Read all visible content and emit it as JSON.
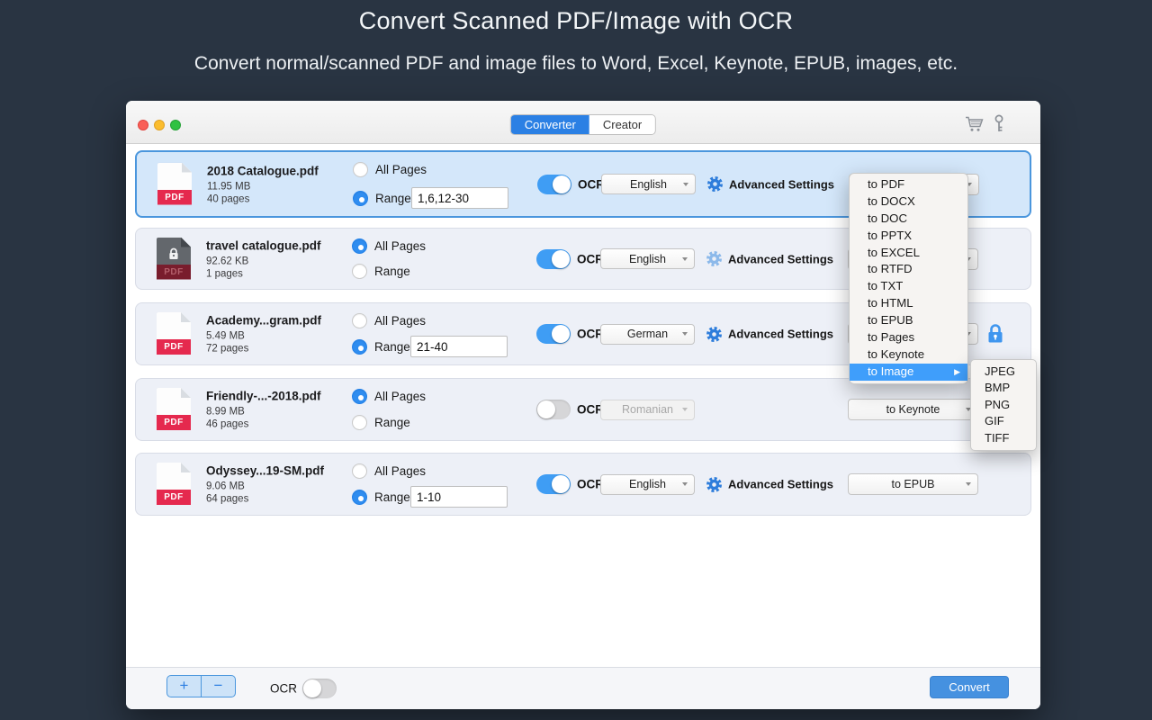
{
  "page": {
    "title": "Convert Scanned PDF/Image with OCR",
    "subtitle": "Convert normal/scanned PDF and image files to Word, Excel, Keynote, EPUB, images, etc."
  },
  "window": {
    "tabs": [
      {
        "label": "Converter",
        "active": true
      },
      {
        "label": "Creator",
        "active": false
      }
    ]
  },
  "labels": {
    "pdf_badge": "PDF"
  },
  "rows": [
    {
      "name": "2018 Catalogue.pdf",
      "size": "11.95 MB",
      "pages": "40 pages",
      "all_pages_label": "All Pages",
      "range_label": "Range",
      "range_value": "1,6,12-30",
      "page_mode": "range",
      "ocr": true,
      "ocr_label": "OCR",
      "language": "English",
      "advanced_label": "Advanced Settings",
      "output": "",
      "selected": true,
      "locked": false
    },
    {
      "name": "travel catalogue.pdf",
      "size": "92.62 KB",
      "pages": "1 pages",
      "all_pages_label": "All Pages",
      "range_label": "Range",
      "page_mode": "all",
      "ocr": true,
      "ocr_label": "OCR",
      "language": "English",
      "advanced_label": "Advanced Settings",
      "output": "",
      "selected": false,
      "locked": true
    },
    {
      "name": "Academy...gram.pdf",
      "size": "5.49 MB",
      "pages": "72 pages",
      "all_pages_label": "All Pages",
      "range_label": "Range",
      "range_value": "21-40",
      "page_mode": "range",
      "ocr": true,
      "ocr_label": "OCR",
      "language": "German",
      "advanced_label": "Advanced Settings",
      "output": "",
      "selected": false,
      "locked": false,
      "has_output_lock": true
    },
    {
      "name": "Friendly-...-2018.pdf",
      "size": "8.99 MB",
      "pages": "46 pages",
      "all_pages_label": "All Pages",
      "range_label": "Range",
      "page_mode": "all",
      "ocr": false,
      "ocr_label": "OCR",
      "language": "Romanian",
      "output": "to Keynote",
      "selected": false,
      "locked": false
    },
    {
      "name": "Odyssey...19-SM.pdf",
      "size": "9.06 MB",
      "pages": "64 pages",
      "all_pages_label": "All Pages",
      "range_label": "Range",
      "range_value": "1-10",
      "page_mode": "range",
      "ocr": true,
      "ocr_label": "OCR",
      "language": "English",
      "advanced_label": "Advanced Settings",
      "output": "to EPUB",
      "selected": false,
      "locked": false
    }
  ],
  "menu": {
    "items": [
      "to PDF",
      "to DOCX",
      "to DOC",
      "to PPTX",
      "to EXCEL",
      "to RTFD",
      "to TXT",
      "to HTML",
      "to EPUB",
      "to Pages",
      "to Keynote",
      "to Image"
    ],
    "highlighted": "to Image",
    "submenu": [
      "JPEG",
      "BMP",
      "PNG",
      "GIF",
      "TIFF"
    ]
  },
  "footer": {
    "add_label": "+",
    "remove_label": "−",
    "ocr_label": "OCR",
    "convert_label": "Convert"
  },
  "icons": {
    "submenu_arrow": "▶",
    "names": [
      "cart-icon",
      "key-icon",
      "gear-icon",
      "lock-icon",
      "chevron-down-icon",
      "pdf-file-icon"
    ]
  },
  "colors": {
    "background": "#293442",
    "accent_blue": "#2b80e4",
    "selected_row": "#d4e7fa",
    "row_bg": "#edf0f7",
    "menu_highlight": "#3f9efb",
    "pdf_red": "#e5294e",
    "toggle_on": "#3f9df4",
    "convert_button": "#4591e0"
  }
}
